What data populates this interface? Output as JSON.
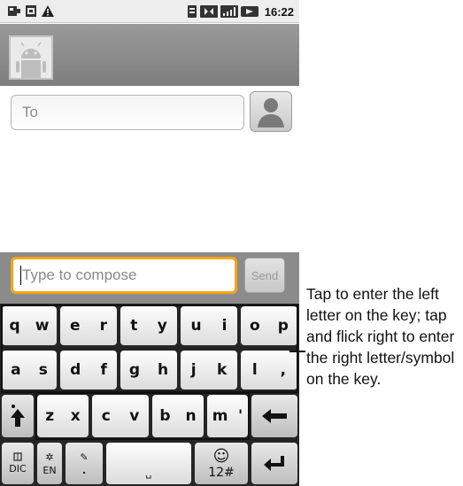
{
  "status_bar": {
    "time": "16:22",
    "icons": [
      "usb-icon",
      "sd-card-icon",
      "warning-icon",
      "sim-icon",
      "data-icon",
      "signal-icon",
      "battery-icon"
    ]
  },
  "to_field": {
    "placeholder": "To"
  },
  "compose": {
    "placeholder": "Type to compose",
    "send_label": "Send"
  },
  "keyboard": {
    "rows": [
      [
        [
          "q",
          "w"
        ],
        [
          "e",
          "r"
        ],
        [
          "t",
          "y"
        ],
        [
          "u",
          "i"
        ],
        [
          "o",
          "p"
        ]
      ],
      [
        [
          "a",
          "s"
        ],
        [
          "d",
          "f"
        ],
        [
          "g",
          "h"
        ],
        [
          "j",
          "k"
        ],
        [
          "l",
          ","
        ]
      ],
      [
        [
          "z",
          "x"
        ],
        [
          "c",
          "v"
        ],
        [
          "b",
          "n"
        ],
        [
          "m",
          "'"
        ]
      ]
    ],
    "bottom": {
      "dic": "DIC",
      "en": "EN",
      "dot": ".",
      "space": "␣",
      "num": "12#"
    }
  },
  "callout_text": "Tap to enter the left letter on the key; tap and flick right to enter the right letter/symbol on the key.",
  "colors": {
    "accent": "#f7a41a",
    "keyboard_bg": "#252525"
  }
}
